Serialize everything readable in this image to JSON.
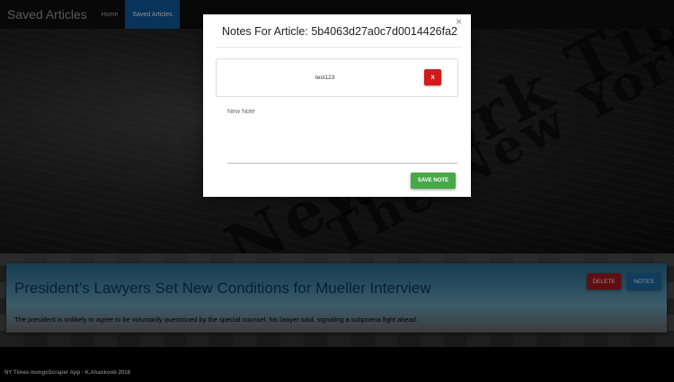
{
  "navbar": {
    "brand": "Saved Articles",
    "links": [
      {
        "label": "Home",
        "active": false
      },
      {
        "label": "Saved Articles",
        "active": true
      }
    ]
  },
  "hero": {
    "backdrop_words": [
      "The New York Times",
      "The New York Times"
    ]
  },
  "article": {
    "title": "President’s Lawyers Set New Conditions for Mueller Interview",
    "summary": "The president is unlikely to agree to be voluntarily questioned by the special counsel, his lawyer said, signaling a subpoena fight ahead.",
    "delete_label": "DELETE",
    "notes_label": "NOTES"
  },
  "footer": {
    "text": "NY Times mongoScraper App - K.Ahankoob 2018"
  },
  "modal": {
    "title": "Notes For Article: 5b4063d27a0c7d0014426fa2",
    "close_glyph": "×",
    "notes": [
      {
        "text": "test123",
        "delete_label": "X"
      }
    ],
    "new_note_placeholder": "New Note",
    "new_note_value": "",
    "save_label": "SAVE NOTE"
  },
  "colors": {
    "nav_active": "#0f5ea6",
    "delete": "#b01a22",
    "notes": "#1d6fb0",
    "save": "#47a847",
    "title": "#0d3a63"
  }
}
